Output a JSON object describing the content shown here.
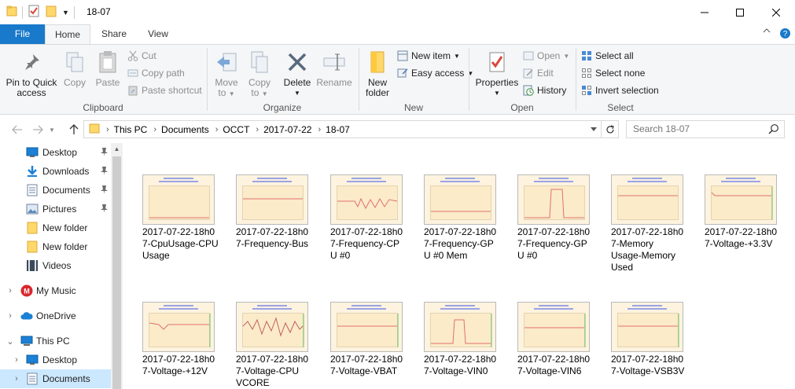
{
  "window": {
    "title": "18-07"
  },
  "tabs": {
    "file": "File",
    "home": "Home",
    "share": "Share",
    "view": "View"
  },
  "ribbon": {
    "clipboard": {
      "label": "Clipboard",
      "pin_line1": "Pin to Quick",
      "pin_line2": "access",
      "copy": "Copy",
      "paste": "Paste",
      "cut": "Cut",
      "copy_path": "Copy path",
      "paste_shortcut": "Paste shortcut"
    },
    "organize": {
      "label": "Organize",
      "move_to_line1": "Move",
      "move_to_line2": "to",
      "copy_to_line1": "Copy",
      "copy_to_line2": "to",
      "delete": "Delete",
      "rename": "Rename"
    },
    "new": {
      "label": "New",
      "new_folder_line1": "New",
      "new_folder_line2": "folder",
      "new_item": "New item",
      "easy_access": "Easy access"
    },
    "open": {
      "label": "Open",
      "properties": "Properties",
      "open": "Open",
      "edit": "Edit",
      "history": "History"
    },
    "select": {
      "label": "Select",
      "select_all": "Select all",
      "select_none": "Select none",
      "invert_selection": "Invert selection"
    }
  },
  "address": {
    "crumbs": [
      "This PC",
      "Documents",
      "OCCT",
      "2017-07-22",
      "18-07"
    ]
  },
  "search": {
    "placeholder": "Search 18-07"
  },
  "nav": {
    "items": [
      {
        "label": "Desktop"
      },
      {
        "label": "Downloads"
      },
      {
        "label": "Documents"
      },
      {
        "label": "Pictures"
      },
      {
        "label": "New folder"
      },
      {
        "label": "New folder"
      },
      {
        "label": "Videos"
      },
      {
        "label": "My Music"
      },
      {
        "label": "OneDrive"
      },
      {
        "label": "This PC"
      },
      {
        "label": "Desktop"
      },
      {
        "label": "Documents"
      }
    ]
  },
  "files": [
    {
      "name": "2017-07-22-18h07-CpuUsage-CPU Usage",
      "line1": "2017-07-22-18h0",
      "line2": "7-CpuUsage-CPU",
      "line3": "Usage",
      "line4": ""
    },
    {
      "name": "2017-07-22-18h07-Frequency-Bus",
      "line1": "2017-07-22-18h0",
      "line2": "7-Frequency-Bus",
      "line3": "",
      "line4": ""
    },
    {
      "name": "2017-07-22-18h07-Frequency-CPU #0",
      "line1": "2017-07-22-18h0",
      "line2": "7-Frequency-CP",
      "line3": "U #0",
      "line4": ""
    },
    {
      "name": "2017-07-22-18h07-Frequency-GPU #0 Mem",
      "line1": "2017-07-22-18h0",
      "line2": "7-Frequency-GP",
      "line3": "U #0 Mem",
      "line4": ""
    },
    {
      "name": "2017-07-22-18h07-Frequency-GPU #0",
      "line1": "2017-07-22-18h0",
      "line2": "7-Frequency-GP",
      "line3": "U #0",
      "line4": ""
    },
    {
      "name": "2017-07-22-18h07-Memory Usage-Memory Used",
      "line1": "2017-07-22-18h0",
      "line2": "7-Memory",
      "line3": "Usage-Memory",
      "line4": "Used"
    },
    {
      "name": "2017-07-22-18h07-Voltage-+3.3V",
      "line1": "2017-07-22-18h0",
      "line2": "7-Voltage-+3.3V",
      "line3": "",
      "line4": ""
    },
    {
      "name": "2017-07-22-18h07-Voltage-+12V",
      "line1": "2017-07-22-18h0",
      "line2": "7-Voltage-+12V",
      "line3": "",
      "line4": ""
    },
    {
      "name": "2017-07-22-18h07-Voltage-CPU VCORE",
      "line1": "2017-07-22-18h0",
      "line2": "7-Voltage-CPU",
      "line3": "VCORE",
      "line4": ""
    },
    {
      "name": "2017-07-22-18h07-Voltage-VBAT",
      "line1": "2017-07-22-18h0",
      "line2": "7-Voltage-VBAT",
      "line3": "",
      "line4": ""
    },
    {
      "name": "2017-07-22-18h07-Voltage-VIN0",
      "line1": "2017-07-22-18h0",
      "line2": "7-Voltage-VIN0",
      "line3": "",
      "line4": ""
    },
    {
      "name": "2017-07-22-18h07-Voltage-VIN6",
      "line1": "2017-07-22-18h0",
      "line2": "7-Voltage-VIN6",
      "line3": "",
      "line4": ""
    },
    {
      "name": "2017-07-22-18h07-Voltage-VSB3V",
      "line1": "2017-07-22-18h0",
      "line2": "7-Voltage-VSB3V",
      "line3": "",
      "line4": ""
    }
  ],
  "colors": {
    "file_tab": "#1979ca",
    "selection": "#cce8ff",
    "ribbon_bg": "#f5f6f7",
    "thumb_bg": "#fdf3df"
  }
}
